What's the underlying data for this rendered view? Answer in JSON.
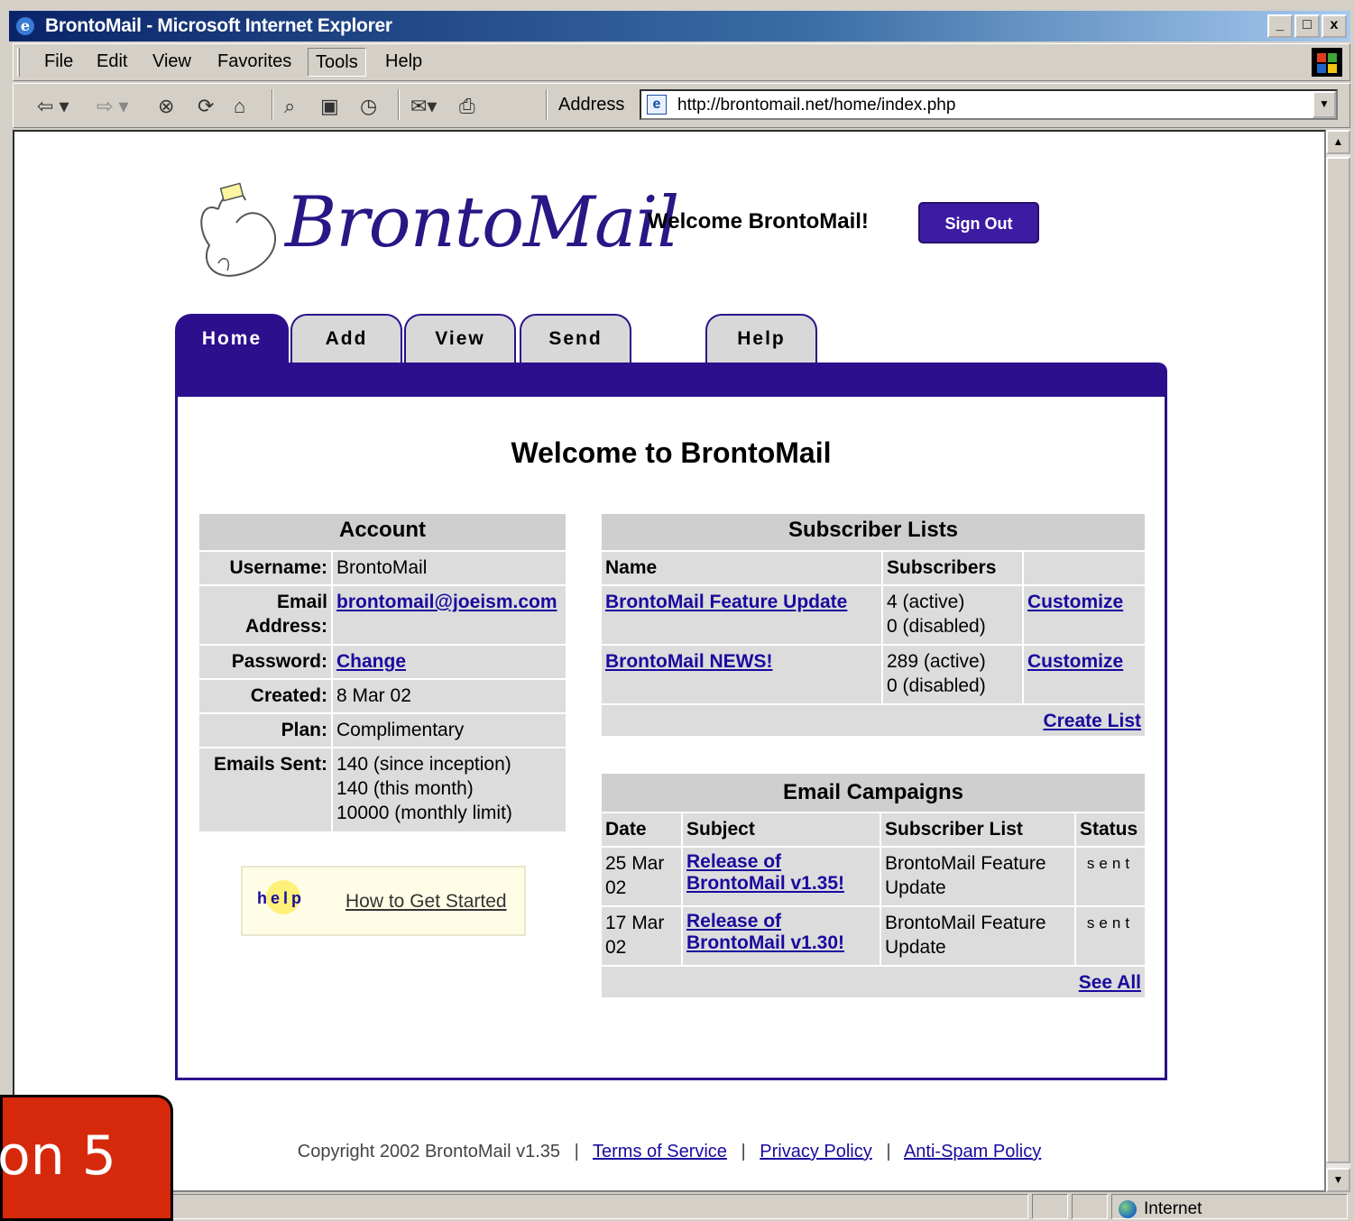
{
  "window": {
    "title": "BrontoMail - Microsoft Internet Explorer",
    "buttons": [
      "_",
      "□",
      "x"
    ]
  },
  "menu": [
    "File",
    "Edit",
    "View",
    "Favorites",
    "Tools",
    "Help"
  ],
  "toolbar": {
    "address_label": "Address",
    "url": "http://brontomail.net/home/index.php"
  },
  "header": {
    "logo_text": "BrontoMail",
    "welcome": "Welcome BrontoMail!",
    "sign_out": "Sign Out"
  },
  "tabs": [
    "Home",
    "Add",
    "View",
    "Send",
    "Help"
  ],
  "page_title": "Welcome to BrontoMail",
  "account": {
    "heading": "Account",
    "rows": [
      {
        "label": "Username:",
        "value": "BrontoMail"
      },
      {
        "label": "Email Address:",
        "value": "brontomail@joeism.com"
      },
      {
        "label": "Password:",
        "value": "Change"
      },
      {
        "label": "Created:",
        "value": "8 Mar 02"
      },
      {
        "label": "Plan:",
        "value": "Complimentary"
      },
      {
        "label": "Emails Sent:",
        "value1": "140 (since inception)",
        "value2": "140 (this month)",
        "value3": "10000 (monthly limit)"
      }
    ]
  },
  "help_box": {
    "icon_text": "help",
    "link": "How to Get Started"
  },
  "subscriber_lists": {
    "heading": "Subscriber Lists",
    "columns": [
      "Name",
      "Subscribers"
    ],
    "rows": [
      {
        "name": "BrontoMail Feature Update",
        "active": "4 (active)",
        "disabled": "0 (disabled)",
        "action": "Customize"
      },
      {
        "name": "BrontoMail NEWS!",
        "active": "289 (active)",
        "disabled": "0 (disabled)",
        "action": "Customize"
      }
    ],
    "create": "Create List"
  },
  "campaigns": {
    "heading": "Email Campaigns",
    "columns": [
      "Date",
      "Subject",
      "Subscriber List",
      "Status"
    ],
    "rows": [
      {
        "date1": "25 Mar",
        "date2": "02",
        "subj1": "Release of",
        "subj2": "BrontoMail v1.35!",
        "list1": "BrontoMail Feature",
        "list2": "Update",
        "status": "sent"
      },
      {
        "date1": "17 Mar",
        "date2": "02",
        "subj1": "Release of",
        "subj2": "BrontoMail v1.30!",
        "list1": "BrontoMail Feature",
        "list2": "Update",
        "status": "sent"
      }
    ],
    "see_all": "See All"
  },
  "footer": {
    "copyright": "Copyright 2002 BrontoMail v1.35",
    "links": [
      "Terms of Service",
      "Privacy Policy",
      "Anti-Spam Policy"
    ],
    "separator": "|"
  },
  "status": {
    "zone": "Internet"
  },
  "overlay": {
    "badge_text": "on 5"
  },
  "colors": {
    "brand": "#2c0f8c",
    "link": "#1a0a9e",
    "badge": "#d6290c"
  }
}
